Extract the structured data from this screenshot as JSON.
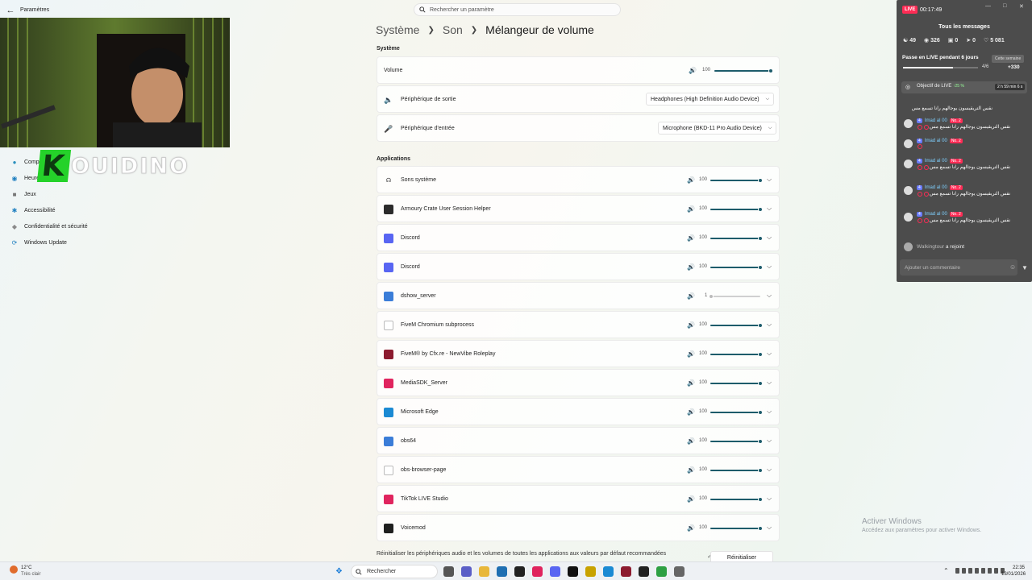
{
  "window": {
    "title": "Paramètres",
    "back_icon": "back-arrow-icon"
  },
  "search": {
    "placeholder": "Rechercher un paramètre"
  },
  "breadcrumb": {
    "level1": "Système",
    "level2": "Son",
    "current": "Mélangeur de volume"
  },
  "sidebar": {
    "items": [
      {
        "label": "Comptes",
        "icon": "person-icon"
      },
      {
        "label": "Heure et langue",
        "icon": "globe-icon"
      },
      {
        "label": "Jeux",
        "icon": "gamepad-icon"
      },
      {
        "label": "Accessibilité",
        "icon": "accessibility-icon"
      },
      {
        "label": "Confidentialité et sécurité",
        "icon": "shield-icon"
      },
      {
        "label": "Windows Update",
        "icon": "update-icon"
      }
    ]
  },
  "overlay": {
    "logo_first": "K",
    "logo_rest": "OUIDINO"
  },
  "system": {
    "heading": "Système",
    "volume_label": "Volume",
    "volume_value": "100",
    "output_label": "Périphérique de sortie",
    "output_value": "Headphones (High Definition Audio Device)",
    "input_label": "Périphérique d'entrée",
    "input_value": "Microphone (BKD-11 Pro Audio Device)"
  },
  "applications": {
    "heading": "Applications",
    "items": [
      {
        "name": "Sons système",
        "value": "100",
        "level": 1,
        "color": "#444444",
        "icon": "headphones-icon"
      },
      {
        "name": "Armoury Crate User Session Helper",
        "value": "100",
        "level": 1,
        "color": "#2b2b2b",
        "icon": "armoury-icon"
      },
      {
        "name": "Discord",
        "value": "100",
        "level": 1,
        "color": "#5865f2",
        "icon": "discord-icon"
      },
      {
        "name": "Discord",
        "value": "100",
        "level": 1,
        "color": "#5865f2",
        "icon": "discord-icon"
      },
      {
        "name": "dshow_server",
        "value": "1",
        "level": 0.01,
        "color": "#3b7dd8",
        "icon": "window-icon"
      },
      {
        "name": "FiveM Chromium subprocess",
        "value": "100",
        "level": 1,
        "color": "#ffffff",
        "icon": "file-icon"
      },
      {
        "name": "FiveM® by Cfx.re - NewVibe Roleplay",
        "value": "100",
        "level": 1,
        "color": "#8c1b2f",
        "icon": "fivem-icon"
      },
      {
        "name": "MediaSDK_Server",
        "value": "100",
        "level": 1,
        "color": "#e0245e",
        "icon": "tiktok-icon"
      },
      {
        "name": "Microsoft Edge",
        "value": "100",
        "level": 1,
        "color": "#1b8ad3",
        "icon": "edge-icon"
      },
      {
        "name": "obs64",
        "value": "100",
        "level": 1,
        "color": "#3b7dd8",
        "icon": "window-icon"
      },
      {
        "name": "obs-browser-page",
        "value": "100",
        "level": 1,
        "color": "#ffffff",
        "icon": "file-icon"
      },
      {
        "name": "TikTok LIVE Studio",
        "value": "100",
        "level": 1,
        "color": "#e0245e",
        "icon": "tiktok-icon"
      },
      {
        "name": "Voicemod",
        "value": "100",
        "level": 1,
        "color": "#1f1f1f",
        "icon": "voicemod-icon"
      }
    ]
  },
  "reset": {
    "text": "Réinitialiser les périphériques audio et les volumes de toutes les applications aux valeurs par défaut recommandées",
    "button": "Réinitialiser"
  },
  "watermark": {
    "line1": "Activer Windows",
    "line2": "Accédez aux paramètres pour activer Windows."
  },
  "live": {
    "badge": "LIVE",
    "time": "00:17:49",
    "heading": "Tous les messages",
    "stats": [
      "49",
      "326",
      "0",
      "0",
      "5 081"
    ],
    "pass_text": "Passe en LIVE pendant 6 jours",
    "week": "Cette semaine",
    "pass_count": "4/6",
    "pass_progress": 0.67,
    "coins": "+330",
    "objective": "Objectif de LIVE",
    "objective_pct": "↑25 %",
    "objective_time": "2 h 59 min 6 s",
    "first_text": "نقس التريقيسون يوجالهم رانا تسمع مس",
    "messages": [
      {
        "user": "Imad al 00",
        "level": "4",
        "rank": "No. 2",
        "text": "نقس التريقيسون يوجالهم رانا تسمع مس"
      },
      {
        "user": "Imad al 00",
        "level": "4",
        "rank": "No. 2",
        "text": ""
      },
      {
        "user": "Imad al 00",
        "level": "4",
        "rank": "No. 2",
        "text": "نقس التريقيسون يوجالهم رانا تسمع مس"
      },
      {
        "user": "Imad al 00",
        "level": "4",
        "rank": "No. 2",
        "text": "نقس التريقيسون يوجالهم رانا تسمع مس"
      },
      {
        "user": "Imad al 00",
        "level": "4",
        "rank": "No. 2",
        "text": "نقس التريقيسون يوجالهم رانا تسمع مس"
      }
    ],
    "joined_user": "Walkingtour",
    "joined_text": "a rejoint",
    "comment_placeholder": "Ajouter un commentaire"
  },
  "taskbar": {
    "weather_temp": "12°C",
    "weather_text": "Très clair",
    "search": "Rechercher",
    "time": "22:35",
    "date": "13/01/2026"
  }
}
